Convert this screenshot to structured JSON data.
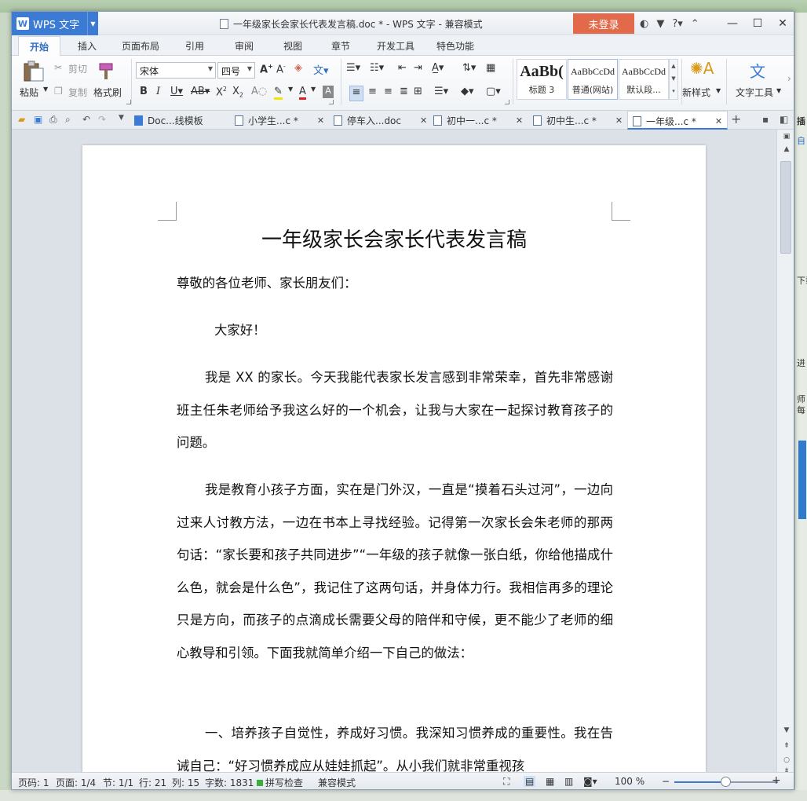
{
  "app": {
    "menu_label": "WPS 文字",
    "window_title": "一年级家长会家长代表发言稿.doc * - WPS 文字 - 兼容模式",
    "login": "未登录"
  },
  "ribbon_tabs": [
    "开始",
    "插入",
    "页面布局",
    "引用",
    "审阅",
    "视图",
    "章节",
    "开发工具",
    "特色功能"
  ],
  "clipboard": {
    "paste": "粘贴",
    "cut": "剪切",
    "copy": "复制",
    "format_painter": "格式刷"
  },
  "font": {
    "name": "宋体",
    "size": "四号"
  },
  "styles": [
    {
      "sample": "AaBb(",
      "name": "标题 3"
    },
    {
      "sample": "AaBbCcDd",
      "name": "普通(网站)"
    },
    {
      "sample": "AaBbCcDd",
      "name": "默认段..."
    }
  ],
  "ribbon_right": {
    "new_style": "新样式",
    "text_tools": "文字工具"
  },
  "doc_tabs": [
    "Doc...线模板",
    "小学生...c *",
    "停车入...doc",
    "初中一...c *",
    "初中生...c *",
    "一年级...c *"
  ],
  "document": {
    "title": "一年级家长会家长代表发言稿",
    "paragraphs": [
      "尊敬的各位老师、家长朋友们：",
      "大家好！",
      "我是 XX 的家长。今天我能代表家长发言感到非常荣幸，首先非常感谢班主任朱老师给予我这么好的一个机会，让我与大家在一起探讨教育孩子的问题。",
      "我是教育小孩子方面，实在是门外汉，一直是“摸着石头过河”，一边向过来人讨教方法，一边在书本上寻找经验。记得第一次家长会朱老师的那两句话：“家长要和孩子共同进步”“一年级的孩子就像一张白纸，你给他描成什么色，就会是什么色”，我记住了这两句话，并身体力行。我相信再多的理论只是方向，而孩子的点滴成长需要父母的陪伴和守候，更不能少了老师的细心教导和引领。下面我就简单介绍一下自己的做法：",
      "一、培养孩子自觉性，养成好习惯。我深知习惯养成的重要性。我在告诫自己：“好习惯养成应从娃娃抓起”。从小我们就非常重视孩"
    ]
  },
  "status": {
    "page": "页码: 1",
    "pages": "页面: 1/4",
    "section": "节: 1/1",
    "row": "行: 21",
    "col": "列: 15",
    "words": "字数: 1831",
    "spell": "拼写检查",
    "mode": "兼容模式",
    "zoom": "100 %"
  },
  "desktop_fragments": [
    "插",
    "自",
    "下载",
    "进",
    "师",
    "每"
  ],
  "colors": {
    "accent": "#3b7bd4",
    "login": "#e2694a",
    "spell_ok": "#3cae3c"
  }
}
